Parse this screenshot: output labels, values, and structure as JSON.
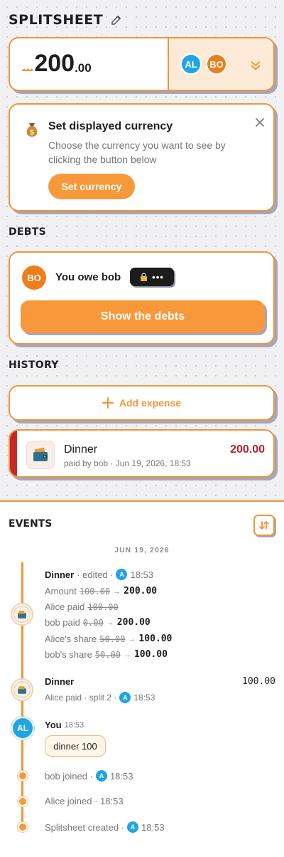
{
  "app": {
    "title": "SPLITSHEET"
  },
  "total": {
    "dots": "...",
    "whole": "200",
    "decimals": ".00"
  },
  "members": {
    "a_initials": "AL",
    "b_initials": "BO"
  },
  "colors": {
    "accent": "#f0953a",
    "blue": "#1fa4e4",
    "red": "#c62828"
  },
  "currency_card": {
    "title": "Set displayed currency",
    "description": "Choose the currency you want to see by clicking the button below",
    "button": "Set currency"
  },
  "debts": {
    "section": "DEBTS",
    "avatar": "BO",
    "text": "You owe bob",
    "hidden_amount": "•••",
    "button": "Show the debts"
  },
  "history": {
    "section": "HISTORY",
    "add_label": "Add expense",
    "expense": {
      "name": "Dinner",
      "subtitle": "paid by bob · Jun 19, 2026, 18:53",
      "amount": "200.00"
    }
  },
  "events": {
    "section": "EVENTS",
    "date": "JUN 19, 2026",
    "edit": {
      "title": "Dinner",
      "action": "· edited ·",
      "avatar": "A",
      "time": "18:53",
      "changes": [
        {
          "label": "Amount",
          "old": "100.00",
          "new": "200.00"
        },
        {
          "label": "Alice paid",
          "old": "100.00",
          "new": ""
        },
        {
          "label": "bob paid",
          "old": "0.00",
          "new": "200.00"
        },
        {
          "label": "Alice's share",
          "old": "50.00",
          "new": "100.00"
        },
        {
          "label": "bob's share",
          "old": "50.00",
          "new": "100.00"
        }
      ]
    },
    "created": {
      "title": "Dinner",
      "amount": "100.00",
      "sub": "Alice paid · split 2 ·",
      "avatar": "A",
      "time": "18:53"
    },
    "message": {
      "avatar": "AL",
      "author": "You",
      "time": "18:53",
      "text": "dinner 100"
    },
    "bob_joined": {
      "text": "bob joined ·",
      "avatar": "A",
      "time": "18:53"
    },
    "alice_joined": {
      "text": "Alice joined · 18:53"
    },
    "sheet_created": {
      "text": "Splitsheet created ·",
      "avatar": "A",
      "time": "18:53"
    }
  }
}
